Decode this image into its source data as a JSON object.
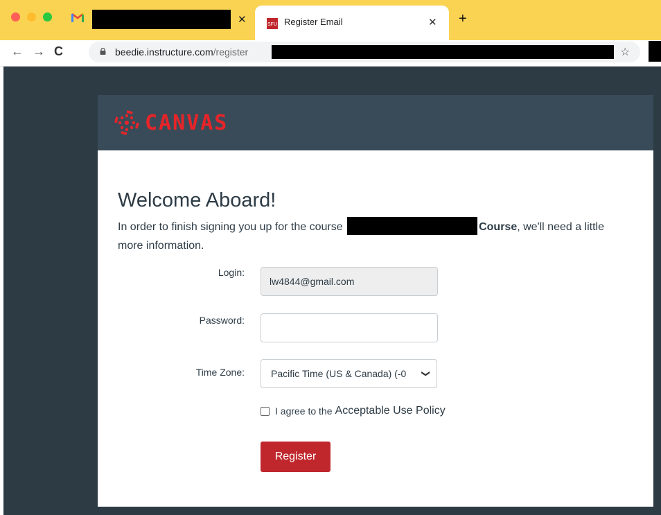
{
  "browser": {
    "tabs": [
      {
        "title": "",
        "close": "✕"
      },
      {
        "title": "Register Email",
        "close": "✕",
        "favicon_text": "SFU"
      }
    ],
    "new_tab": "+",
    "url_host": "beedie.instructure.com",
    "url_path": "/register",
    "star": "☆",
    "back": "←",
    "forward": "→",
    "reload": "C"
  },
  "brand": {
    "wordmark": "CANVAS",
    "color": "#e72429"
  },
  "page": {
    "title": "Welcome Aboard!",
    "intro_prefix": "In order to finish signing you up for the course",
    "intro_course_word": "Course",
    "intro_suffix": ", we'll need a little more information."
  },
  "form": {
    "login_label": "Login:",
    "login_value": "lw4844@gmail.com",
    "password_label": "Password:",
    "password_value": "",
    "timezone_label": "Time Zone:",
    "timezone_value": "Pacific Time (US & Canada) (-0",
    "agree_text": "I agree to the",
    "aup_link": "Acceptable Use Policy",
    "register_label": "Register"
  },
  "colors": {
    "tabstrip": "#fad352",
    "page_bg": "#2d3b45",
    "header_bg": "#394b58",
    "button": "#c0272d"
  }
}
